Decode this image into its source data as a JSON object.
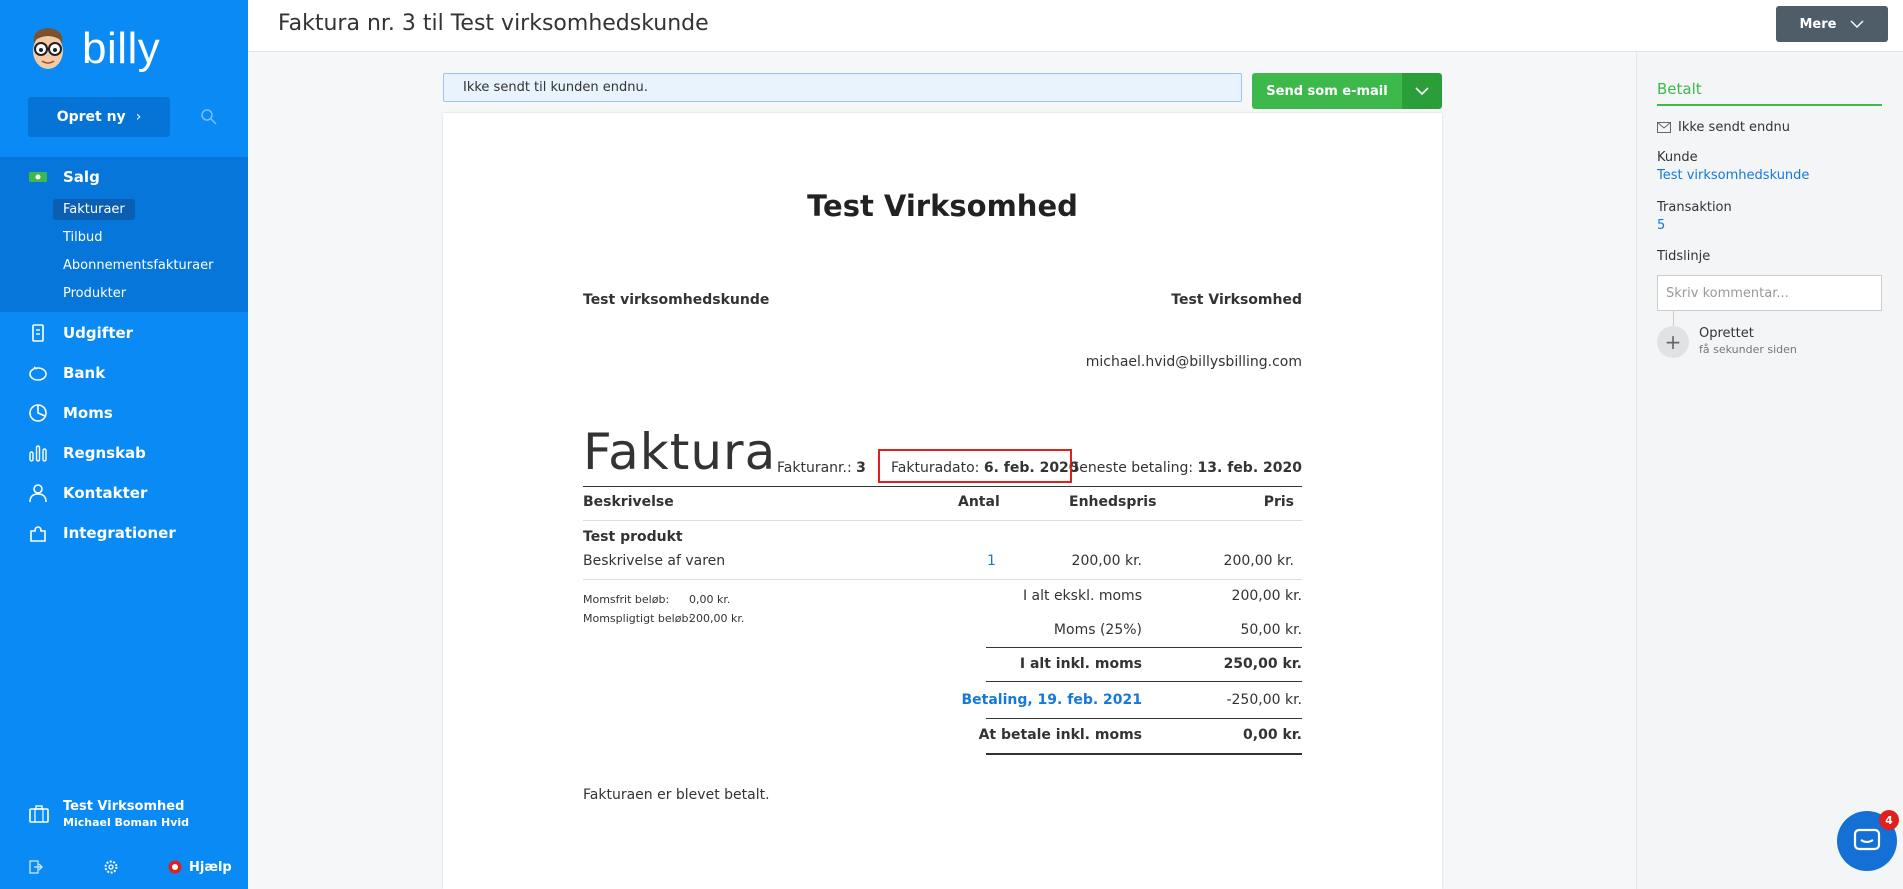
{
  "sidebar": {
    "logo_text": "billy",
    "create_button": "Opret ny",
    "nav": {
      "salg": "Salg",
      "udgifter": "Udgifter",
      "bank": "Bank",
      "moms": "Moms",
      "regnskab": "Regnskab",
      "kontakter": "Kontakter",
      "integrationer": "Integrationer"
    },
    "sub": {
      "fakturaer": "Fakturaer",
      "tilbud": "Tilbud",
      "abonnement": "Abonnementsfakturaer",
      "produkter": "Produkter"
    },
    "company_name": "Test Virksomhed",
    "user_name": "Michael Boman Hvid",
    "help": "Hjælp",
    "accent": "#0a8af5"
  },
  "header": {
    "title": "Faktura nr. 3 til Test virksomhedskunde",
    "more_button": "Mere"
  },
  "actions": {
    "status_text": "Ikke sendt til kunden endnu.",
    "send_button": "Send som e-mail"
  },
  "invoice": {
    "company": "Test Virksomhed",
    "customer": "Test virksomhedskunde",
    "sender": "Test Virksomhed",
    "email": "michael.hvid@billysbilling.com",
    "doc_title": "Faktura",
    "number_label": "Fakturanr.:",
    "number": "3",
    "date_label": "Fakturadato:",
    "date": "6. feb. 2020",
    "due_label": "Seneste betaling:",
    "due": "13. feb. 2020",
    "columns": {
      "desc": "Beskrivelse",
      "qty": "Antal",
      "unit": "Enhedspris",
      "price": "Pris"
    },
    "line": {
      "product": "Test produkt",
      "description": "Beskrivelse af varen",
      "qty": "1",
      "unit_price": "200,00 kr.",
      "price": "200,00 kr."
    },
    "vat_info": {
      "free_label": "Momsfrit beløb:",
      "free_value": "0,00 kr.",
      "liable_label": "Momspligtigt beløb:",
      "liable_value": "200,00 kr."
    },
    "totals": {
      "excl_label": "I alt ekskl. moms",
      "excl_value": "200,00 kr.",
      "vat_label": "Moms (25%)",
      "vat_value": "50,00 kr.",
      "incl_label": "I alt inkl. moms",
      "incl_value": "250,00 kr.",
      "payment_label": "Betaling, 19. feb. 2021",
      "payment_value": "-250,00 kr.",
      "due_label": "At betale inkl. moms",
      "due_value": "0,00 kr."
    },
    "footer_note": "Fakturaen er blevet betalt."
  },
  "right_panel": {
    "status": "Betalt",
    "sent_status": "Ikke sendt endnu",
    "customer_label": "Kunde",
    "customer_link": "Test virksomhedskunde",
    "transaction_label": "Transaktion",
    "transaction_link": "5",
    "timeline_label": "Tidslinje",
    "comment_placeholder": "Skriv kommentar...",
    "event_title": "Oprettet",
    "event_time": "få sekunder siden"
  },
  "chat": {
    "badge": "4"
  }
}
